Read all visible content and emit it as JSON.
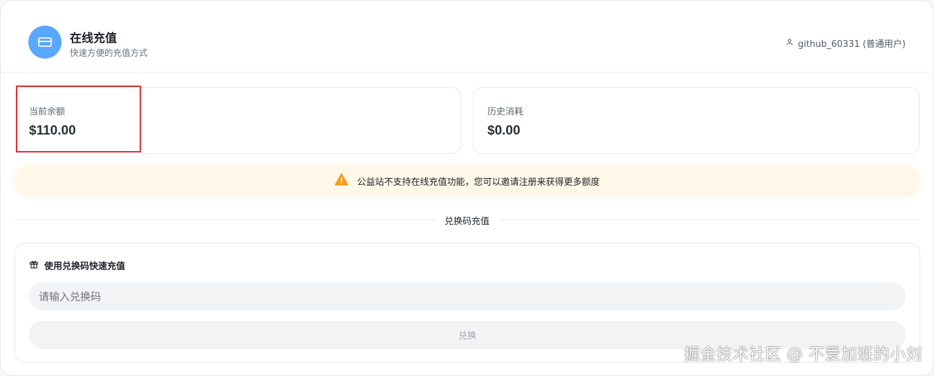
{
  "header": {
    "icon": "credit-card-icon",
    "title": "在线充值",
    "subtitle": "快速方便的充值方式",
    "user_icon": "user-icon",
    "user_label": "github_60331 (普通用户)"
  },
  "stats": {
    "balance_label": "当前余额",
    "balance_value": "$110.00",
    "history_label": "历史消耗",
    "history_value": "$0.00"
  },
  "notice": {
    "icon": "warning-icon",
    "text": "公益站不支持在线充值功能，您可以邀请注册来获得更多额度"
  },
  "divider_label": "兑换码充值",
  "redeem": {
    "icon": "gift-icon",
    "title": "使用兑换码快速充值",
    "input_value": "",
    "input_placeholder": "请输入兑换码",
    "button_label": "兑换"
  },
  "watermark": "掘金技术社区 @ 不爱加班的小刘",
  "colors": {
    "accent": "#5aa7ff",
    "warning": "#f59a1c",
    "notice_bg": "#fff7e8",
    "highlight": "#d92f2f"
  }
}
